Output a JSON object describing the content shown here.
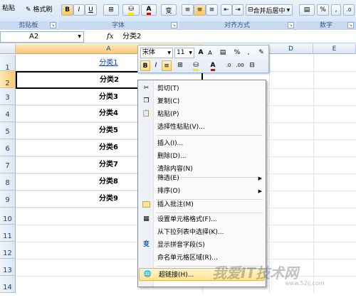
{
  "ribbon": {
    "paste_label": "粘贴",
    "format_painter": "格式刷",
    "bold": "B",
    "italic": "I",
    "underline": "U",
    "font_color": "A",
    "wen": "变",
    "merge_center": "合并后居中",
    "percent": "%",
    "comma": ",",
    "groups": {
      "clipboard": "剪贴板",
      "font": "字体",
      "alignment": "对齐方式",
      "number": "数字"
    }
  },
  "formula_bar": {
    "name_box": "A2",
    "fx": "fx",
    "content": "分类2"
  },
  "columns": [
    "A",
    "D",
    "E"
  ],
  "rows": [
    "1",
    "2",
    "3",
    "4",
    "5",
    "6",
    "7",
    "8",
    "9",
    "10",
    "11",
    "12",
    "13",
    "14"
  ],
  "cells": {
    "a1": "分类1",
    "a2": "分类2",
    "a3": "分类3",
    "a4": "分类4",
    "a5": "分类5",
    "a6": "分类6",
    "a7": "分类7",
    "a8": "分类8",
    "a9": "分类9"
  },
  "mini_toolbar": {
    "font": "宋体",
    "size": "11",
    "grow": "A",
    "shrink": "A",
    "percent": "%",
    "comma": ",",
    "bold": "B",
    "italic": "I",
    "font_color": "A"
  },
  "context_menu": {
    "cut": "剪切(T)",
    "copy": "复制(C)",
    "paste": "粘贴(P)",
    "paste_special": "选择性粘贴(V)...",
    "insert": "插入(I)...",
    "delete": "删除(D)...",
    "clear": "清除内容(N)",
    "filter": "筛选(E)",
    "sort": "排序(O)",
    "insert_comment": "插入批注(M)",
    "format_cells": "设置单元格格式(F)...",
    "pick_list": "从下拉列表中选择(K)...",
    "phonetic": "显示拼音字段(S)",
    "name_range": "命名单元格区域(R)...",
    "hyperlink": "超链接(H)..."
  },
  "watermark": {
    "main": "我爱IT技术网",
    "sub": "www.52ij.com"
  }
}
